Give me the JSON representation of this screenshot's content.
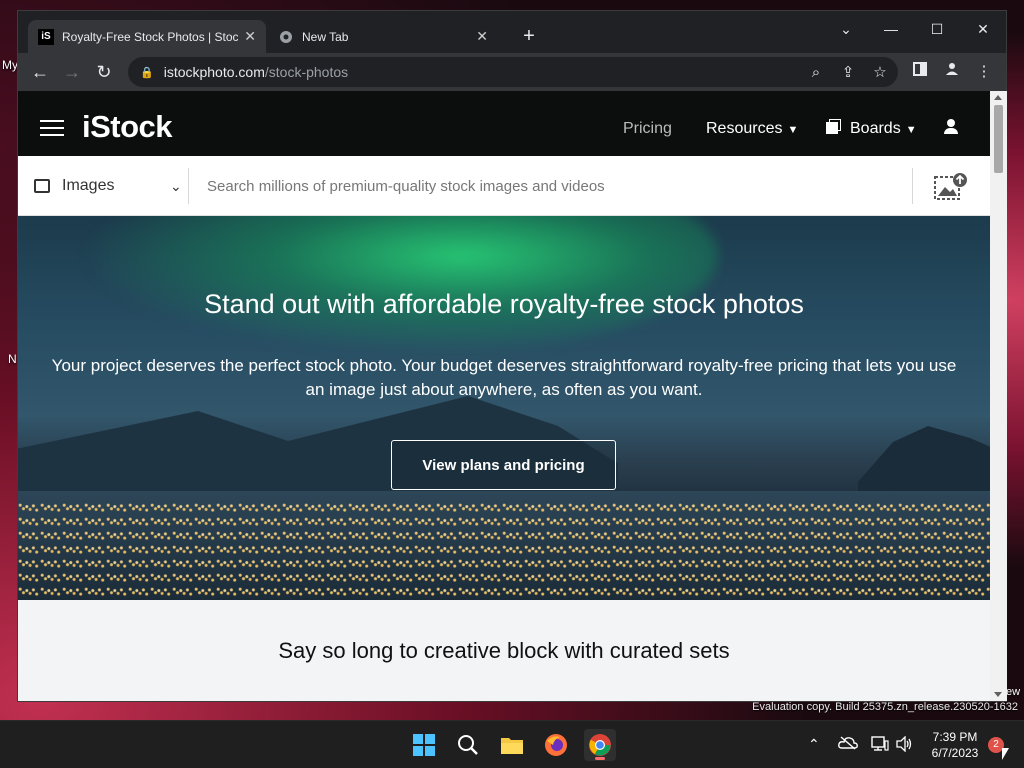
{
  "desktop": {
    "labels": [
      "My",
      "N"
    ],
    "watermark": "Evaluation copy. Build 25375.zn_release.230520-1632",
    "corner_text": "ew"
  },
  "browser": {
    "tabs": [
      {
        "title": "Royalty-Free Stock Photos | Stock",
        "favicon": "iS",
        "active": true
      },
      {
        "title": "New Tab",
        "favicon": "chrome-icon",
        "active": false
      }
    ],
    "new_tab_label": "+",
    "window_controls": {
      "menu": "⌄",
      "minimize": "—",
      "maximize": "☐",
      "close": "✕"
    },
    "url_domain": "istockphoto.com",
    "url_path": "/stock-photos"
  },
  "site": {
    "logo": "iStock",
    "nav": {
      "pricing": "Pricing",
      "resources": "Resources",
      "boards": "Boards"
    },
    "search": {
      "type_label": "Images",
      "placeholder": "Search millions of premium-quality stock images and videos"
    },
    "hero": {
      "title": "Stand out with affordable royalty-free stock photos",
      "subtitle": "Your project deserves the perfect stock photo. Your budget deserves straightforward royalty-free pricing that lets you use an image just about anywhere, as often as you want.",
      "cta": "View plans and pricing"
    },
    "section_title": "Say so long to creative block with curated sets"
  },
  "taskbar": {
    "time": "7:39 PM",
    "date": "6/7/2023",
    "notifications": "2"
  }
}
